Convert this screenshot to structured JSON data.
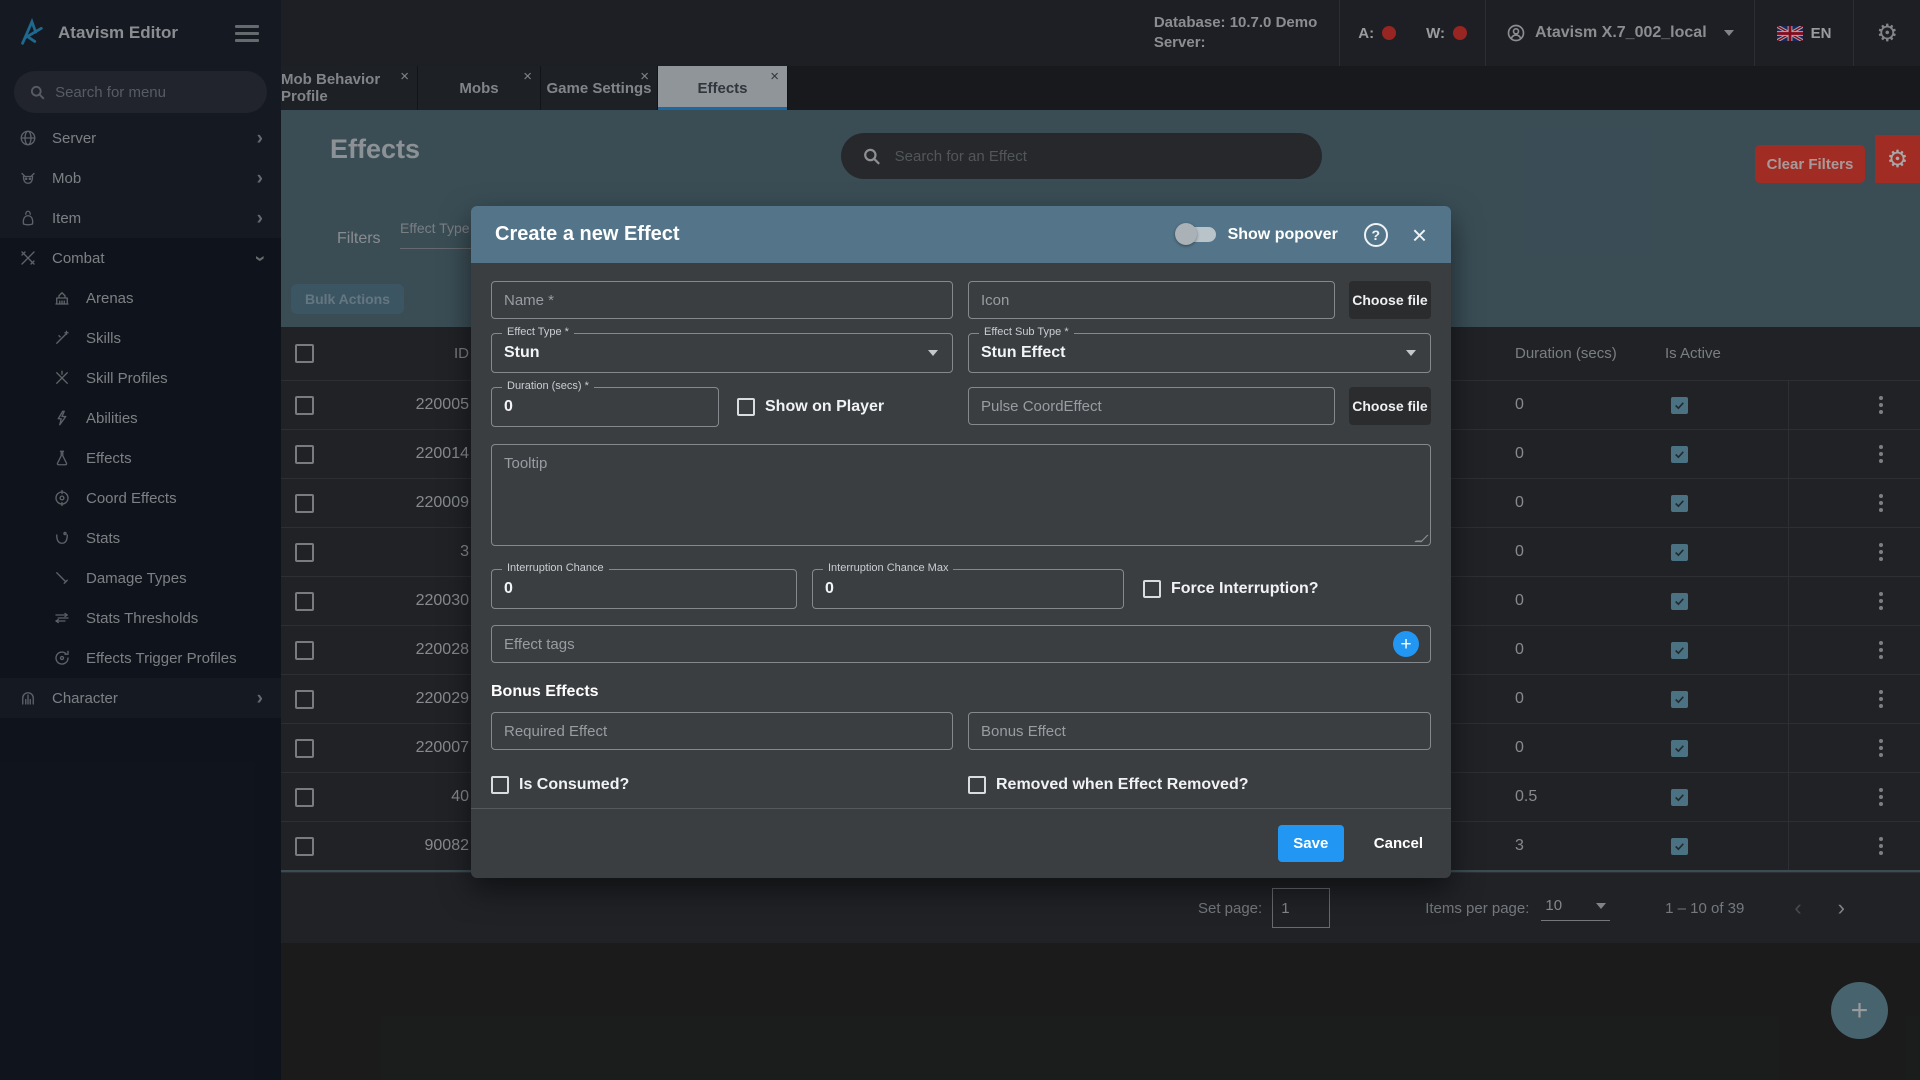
{
  "topbar": {
    "app_title": "Atavism Editor",
    "database_label": "Database: 10.7.0 Demo",
    "server_label": "Server:",
    "a_label": "A:",
    "w_label": "W:",
    "status_color": "#e53935",
    "account_name": "Atavism X.7_002_local",
    "language": "EN"
  },
  "sidebar": {
    "search_placeholder": "Search for menu",
    "items": [
      {
        "label": "Server",
        "icon": "globe-icon"
      },
      {
        "label": "Mob",
        "icon": "mob-icon"
      },
      {
        "label": "Item",
        "icon": "item-bag-icon"
      },
      {
        "label": "Combat",
        "icon": "combat-swords-icon",
        "expanded": true
      },
      {
        "label": "Arenas",
        "icon": "arena-icon",
        "child": true
      },
      {
        "label": "Skills",
        "icon": "skills-wand-icon",
        "child": true
      },
      {
        "label": "Skill Profiles",
        "icon": "skill-profiles-icon",
        "child": true
      },
      {
        "label": "Abilities",
        "icon": "abilities-bolt-icon",
        "child": true
      },
      {
        "label": "Effects",
        "icon": "effects-flask-icon",
        "child": true
      },
      {
        "label": "Coord Effects",
        "icon": "coord-effects-target-icon",
        "child": true
      },
      {
        "label": "Stats",
        "icon": "stats-icon",
        "child": true
      },
      {
        "label": "Damage Types",
        "icon": "damage-types-icon",
        "child": true
      },
      {
        "label": "Stats Thresholds",
        "icon": "stats-thresholds-icon",
        "child": true
      },
      {
        "label": "Effects Trigger Profiles",
        "icon": "effects-trigger-icon",
        "child": true
      },
      {
        "label": "Character",
        "icon": "character-helmet-icon"
      }
    ]
  },
  "tabs": [
    {
      "label": "Mob Behavior Profile",
      "close": "×"
    },
    {
      "label": "Mobs",
      "close": "×"
    },
    {
      "label": "Game Settings",
      "close": "×"
    },
    {
      "label": "Effects",
      "close": "×",
      "active": true
    }
  ],
  "page": {
    "title": "Effects",
    "search_placeholder": "Search for an Effect",
    "clear_filters_label": "Clear Filters",
    "filters_label": "Filters",
    "effect_type_filter_label": "Effect Type",
    "bulk_actions_label": "Bulk Actions"
  },
  "table": {
    "columns": {
      "id": "ID",
      "duration": "Duration (secs)",
      "is_active": "Is Active"
    },
    "rows": [
      {
        "id": "220005",
        "duration": "0",
        "active": true
      },
      {
        "id": "220014",
        "duration": "0",
        "active": true
      },
      {
        "id": "220009",
        "duration": "0",
        "active": true
      },
      {
        "id": "3",
        "duration": "0",
        "active": true
      },
      {
        "id": "220030",
        "duration": "0",
        "active": true
      },
      {
        "id": "220028",
        "duration": "0",
        "active": true
      },
      {
        "id": "220029",
        "duration": "0",
        "active": true
      },
      {
        "id": "220007",
        "duration": "0",
        "active": true
      },
      {
        "id": "40",
        "duration": "0.5",
        "active": true
      },
      {
        "id": "90082",
        "duration": "3",
        "active": true
      }
    ]
  },
  "pagination": {
    "set_page_label": "Set page:",
    "page_value": "1",
    "items_per_page_label": "Items per page:",
    "items_per_page_value": "10",
    "range_label": "1 – 10 of 39",
    "prev": "‹",
    "next": "›"
  },
  "modal": {
    "title": "Create a new Effect",
    "show_popover_label": "Show popover",
    "help_glyph": "?",
    "close_glyph": "×",
    "fields": {
      "name_placeholder": "Name *",
      "icon_placeholder": "Icon",
      "choose_file_label": "Choose file",
      "effect_type_label": "Effect Type *",
      "effect_type_value": "Stun",
      "effect_sub_type_label": "Effect Sub Type *",
      "effect_sub_type_value": "Stun Effect",
      "duration_label": "Duration (secs) *",
      "duration_value": "0",
      "show_on_player_label": "Show on Player",
      "pulse_placeholder": "Pulse CoordEffect",
      "tooltip_placeholder": "Tooltip",
      "interruption_chance_label": "Interruption Chance",
      "interruption_chance_value": "0",
      "interruption_chance_max_label": "Interruption Chance Max",
      "interruption_chance_max_value": "0",
      "force_interruption_label": "Force Interruption?",
      "effect_tags_placeholder": "Effect tags",
      "plus_glyph": "+",
      "bonus_effects_heading": "Bonus Effects",
      "required_effect_placeholder": "Required Effect",
      "bonus_effect_placeholder": "Bonus Effect",
      "is_consumed_label": "Is Consumed?",
      "removed_when_label": "Removed when Effect Removed?"
    },
    "save_label": "Save",
    "cancel_label": "Cancel",
    "accent_color": "#2196f3"
  },
  "fab_glyph": "+"
}
